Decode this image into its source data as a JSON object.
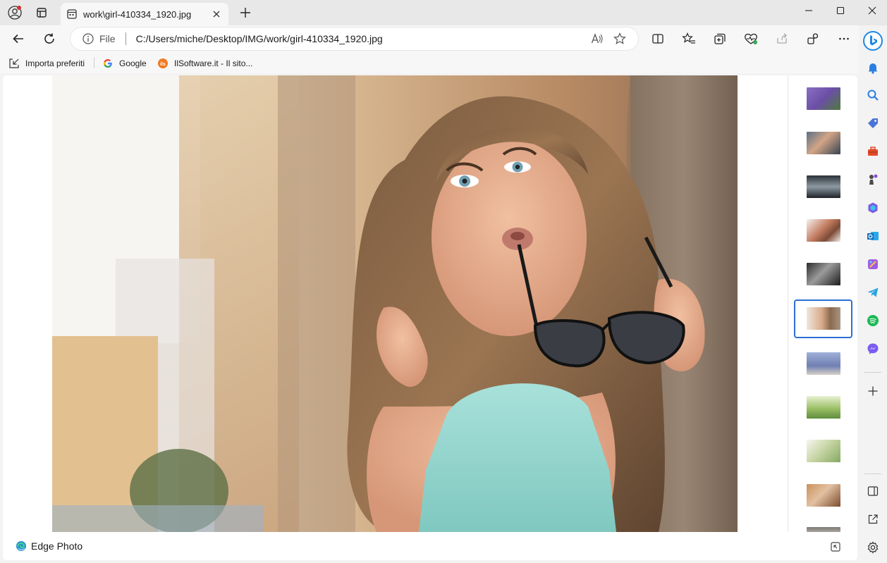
{
  "tab": {
    "title": "work\\girl-410334_1920.jpg"
  },
  "address": {
    "scheme": "File",
    "url": "C:/Users/miche/Desktop/IMG/work/girl-410334_1920.jpg"
  },
  "favorites": [
    {
      "label": "Importa preferiti"
    },
    {
      "label": "Google"
    },
    {
      "label": "IlSoftware.it - Il sito..."
    }
  ],
  "viewer": {
    "app_name": "Edge Photo",
    "selected_thumbnail": 6,
    "thumbnail_count": 11
  },
  "colors": {
    "accent": "#2b6fd6",
    "bing": "#1e88e5",
    "profile_badge": "#d32f2f"
  }
}
